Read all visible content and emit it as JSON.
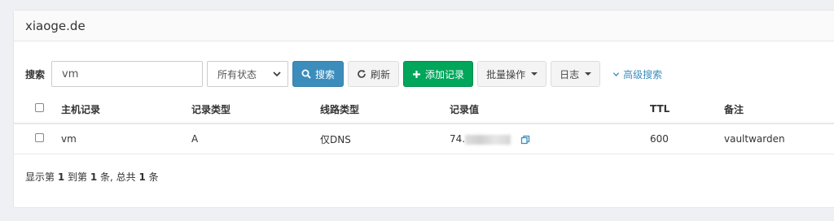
{
  "panel": {
    "title": "xiaoge.de"
  },
  "toolbar": {
    "search_label": "搜索",
    "search_value": "vm",
    "status_selected": "所有状态",
    "search_button": "搜索",
    "refresh_button": "刷新",
    "add_button": "添加记录",
    "batch_button": "批量操作",
    "log_button": "日志",
    "advanced_search": "高级搜索"
  },
  "table": {
    "headers": [
      "主机记录",
      "记录类型",
      "线路类型",
      "记录值",
      "TTL",
      "备注"
    ],
    "rows": [
      {
        "host": "vm",
        "type": "A",
        "line": "仅DNS",
        "value": "74.",
        "ttl": "600",
        "remark": "vaultwarden"
      }
    ]
  },
  "footer": {
    "prefix": "显示第 ",
    "from": "1",
    "mid": " 到第 ",
    "to": "1",
    "mid2": " 条, 总共 ",
    "total": "1",
    "suffix": " 条"
  },
  "colors": {
    "primary": "#3c8dbc",
    "success": "#00a65a"
  }
}
